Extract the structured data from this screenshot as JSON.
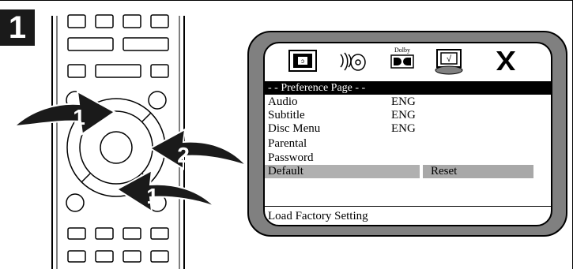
{
  "step": {
    "number": "1"
  },
  "remote": {
    "arrow_labels": [
      "1",
      "2",
      "1"
    ]
  },
  "osd": {
    "icons": [
      {
        "name": "disc-setup-icon"
      },
      {
        "name": "audio-setup-icon"
      },
      {
        "name": "dolby-icon",
        "label": "Dolby"
      },
      {
        "name": "preference-tv-icon"
      },
      {
        "name": "exit-x-icon"
      }
    ],
    "page_title": "- - Preference Page - -",
    "rows": [
      {
        "label": "Audio",
        "value": "ENG"
      },
      {
        "label": "Subtitle",
        "value": "ENG"
      },
      {
        "label": "Disc Menu",
        "value": "ENG"
      },
      {
        "label": "Parental",
        "value": ""
      },
      {
        "label": "Password",
        "value": ""
      },
      {
        "label": "Default",
        "value": ""
      }
    ],
    "selected_option": "Reset",
    "status": "Load Factory Setting"
  },
  "colors": {
    "bezel": "#808080",
    "highlight": "#b0b0b0",
    "arrow": "#1a1a1a"
  }
}
